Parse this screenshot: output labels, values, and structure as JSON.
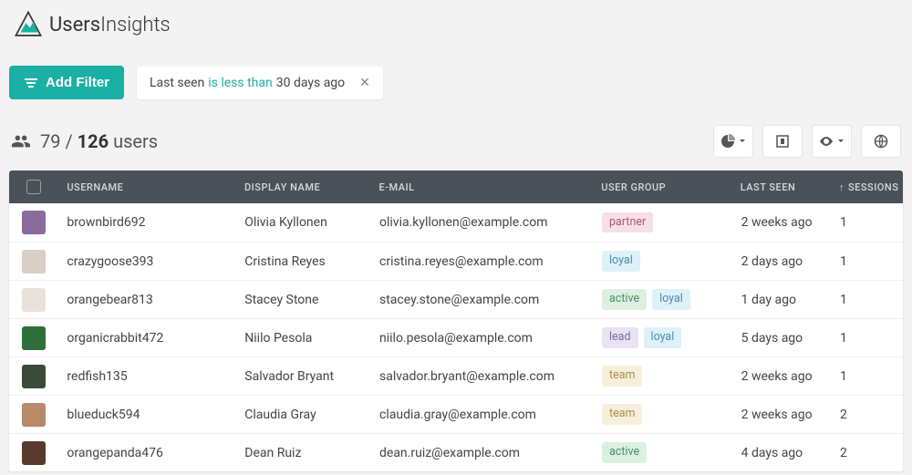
{
  "brand": {
    "name_a": "Users",
    "name_b": "Insights"
  },
  "toolbar": {
    "add_filter_label": "Add Filter"
  },
  "filter_chip": {
    "field": "Last seen",
    "operator": "is less than",
    "value": "30 days ago"
  },
  "count": {
    "filtered": "79",
    "sep": " / ",
    "total": "126",
    "suffix": " users"
  },
  "columns": {
    "username": "Username",
    "display": "Display Name",
    "email": "E-mail",
    "group": "User Group",
    "seen": "Last Seen",
    "sessions": "Sessions",
    "sort_arrow": "↑"
  },
  "tag_colors": {
    "partner": "tag-partner",
    "loyal": "tag-loyal",
    "active": "tag-active",
    "lead": "tag-lead",
    "team": "tag-team"
  },
  "rows": [
    {
      "avatar": "#8a6b9c",
      "username": "brownbird692",
      "display": "Olivia Kyllonen",
      "email": "olivia.kyllonen@example.com",
      "groups": [
        "partner"
      ],
      "seen": "2 weeks ago",
      "sessions": "1"
    },
    {
      "avatar": "#d9cfc4",
      "username": "crazygoose393",
      "display": "Cristina Reyes",
      "email": "cristina.reyes@example.com",
      "groups": [
        "loyal"
      ],
      "seen": "2 days ago",
      "sessions": "1"
    },
    {
      "avatar": "#e8e2da",
      "username": "orangebear813",
      "display": "Stacey Stone",
      "email": "stacey.stone@example.com",
      "groups": [
        "active",
        "loyal"
      ],
      "seen": "1 day ago",
      "sessions": "1"
    },
    {
      "avatar": "#2e6e3a",
      "username": "organicrabbit472",
      "display": "Niilo Pesola",
      "email": "niilo.pesola@example.com",
      "groups": [
        "lead",
        "loyal"
      ],
      "seen": "5 days ago",
      "sessions": "1"
    },
    {
      "avatar": "#3a4b3a",
      "username": "redfish135",
      "display": "Salvador Bryant",
      "email": "salvador.bryant@example.com",
      "groups": [
        "team"
      ],
      "seen": "2 weeks ago",
      "sessions": "1"
    },
    {
      "avatar": "#b78a6a",
      "username": "blueduck594",
      "display": "Claudia Gray",
      "email": "claudia.gray@example.com",
      "groups": [
        "team"
      ],
      "seen": "2 weeks ago",
      "sessions": "2"
    },
    {
      "avatar": "#5b3a2e",
      "username": "orangepanda476",
      "display": "Dean Ruiz",
      "email": "dean.ruiz@example.com",
      "groups": [
        "active"
      ],
      "seen": "4 days ago",
      "sessions": "2"
    }
  ]
}
